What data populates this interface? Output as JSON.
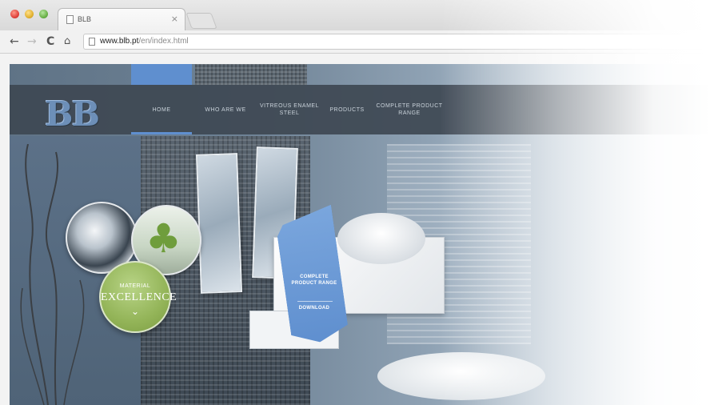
{
  "browser": {
    "tab_title": "BLB",
    "tab_close_glyph": "×",
    "back_glyph": "←",
    "forward_glyph": "→",
    "reload_glyph": "C",
    "home_glyph": "⌂",
    "url_host": "www.blb.pt",
    "url_path": "/en/index.html"
  },
  "site": {
    "logo_text": "BB",
    "nav": {
      "home": "HOME",
      "who_we_are": "WHO ARE WE",
      "vitreous_steel": "VITREOUS ENAMEL STEEL",
      "products": "PRODUCTS",
      "complete_range": "COMPLETE PRODUCT RANGE"
    },
    "badge": {
      "small": "MATERIAL",
      "big": "EXCELLENCE",
      "chevron": "⌄"
    },
    "ribbon": {
      "text": "COMPLETE PRODUCT RANGE",
      "download": "DOWNLOAD"
    },
    "tree_glyph": "♣"
  },
  "colors": {
    "accent_blue": "#5f8fcf",
    "badge_green": "#93b458",
    "nav_bar": "#3e4852"
  },
  "icons": [
    "page-icon",
    "close-icon",
    "back-arrow-icon",
    "forward-arrow-icon",
    "reload-icon",
    "home-icon",
    "chevron-down-icon"
  ]
}
